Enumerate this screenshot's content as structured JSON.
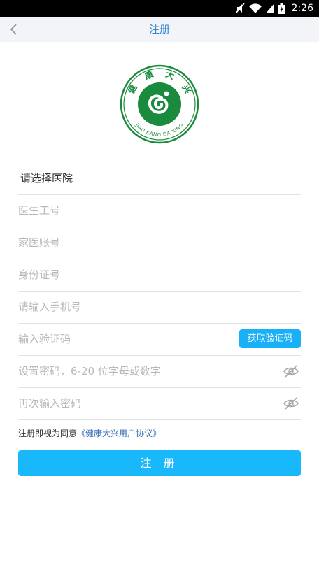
{
  "status": {
    "time": "2:26"
  },
  "nav": {
    "title": "注册"
  },
  "logo": {
    "cn_text": [
      "健",
      "康",
      "大",
      "兴"
    ],
    "en_text": "JIAN KANG DA XING"
  },
  "form": {
    "hospital": "请选择医院",
    "doctor_id": "医生工号",
    "account": "家医账号",
    "id_card": "身份证号",
    "phone": "请输入手机号",
    "code": "输入验证码",
    "code_button": "获取验证码",
    "password": "设置密码，6-20 位字母或数字",
    "password_confirm": "再次输入密码"
  },
  "agreement": {
    "prefix": "注册即视为同意",
    "link": "《健康大兴用户协议》"
  },
  "submit_label": "注 册",
  "colors": {
    "accent": "#19b8fb",
    "logo_green": "#1a8a3c",
    "nav_title": "#2f86d6"
  }
}
